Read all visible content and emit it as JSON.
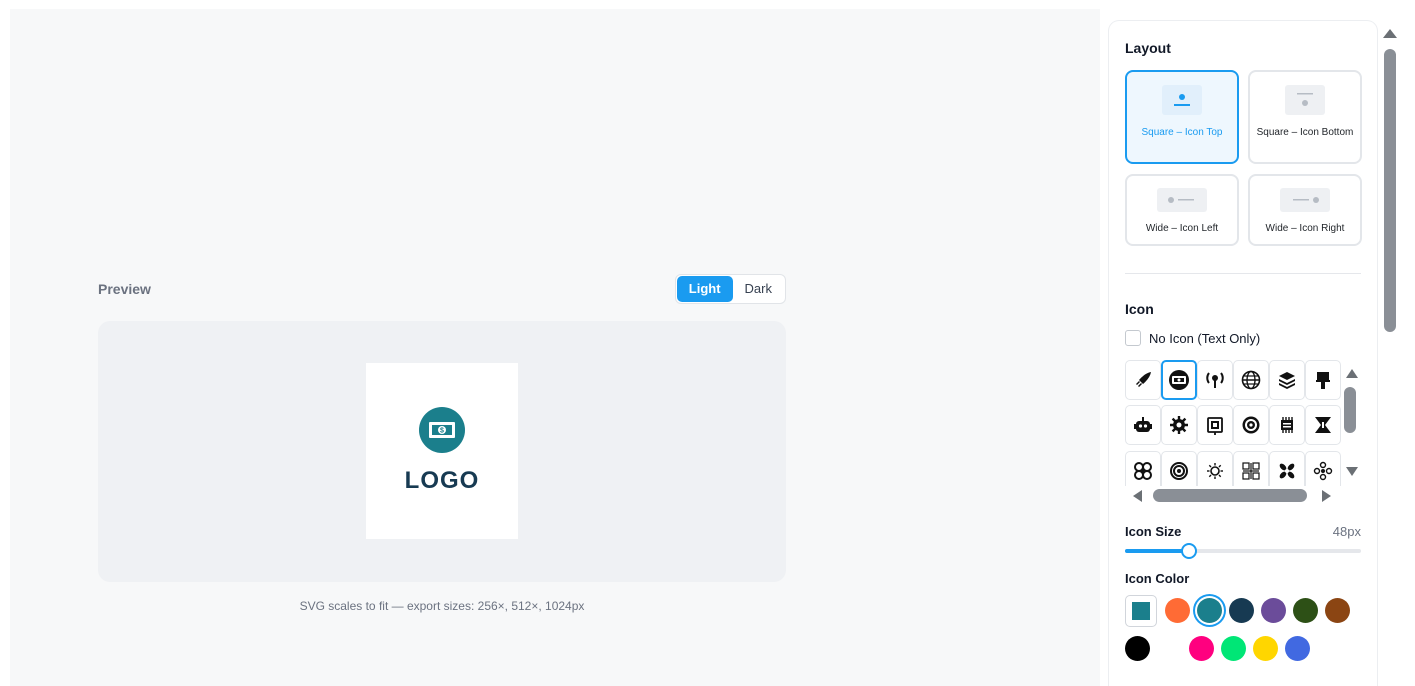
{
  "preview": {
    "title": "Preview",
    "theme_light": "Light",
    "theme_dark": "Dark",
    "logo_text": "LOGO",
    "caption": "SVG scales to fit — export sizes: 256×, 512×, 1024px"
  },
  "layout": {
    "title": "Layout",
    "options": [
      {
        "label": "Square – Icon Top",
        "selected": true
      },
      {
        "label": "Square – Icon Bottom",
        "selected": false
      },
      {
        "label": "Wide – Icon Left",
        "selected": false
      },
      {
        "label": "Wide – Icon Right",
        "selected": false
      }
    ]
  },
  "icon": {
    "title": "Icon",
    "no_icon_label": "No Icon (Text Only)",
    "no_icon_checked": false,
    "grid": [
      [
        "rocket-icon",
        "money-icon",
        "wifi-pin-icon",
        "globe-icon",
        "layers-icon",
        "paint-brush-icon"
      ],
      [
        "robot-icon",
        "gear-icon",
        "circuit-board-icon",
        "target-gear-icon",
        "chip-icon",
        "hourglass-icon"
      ],
      [
        "clover-icon",
        "spiral-icon",
        "sun-icon",
        "grid-pattern-icon",
        "flower-icon",
        "pinwheel-icon"
      ]
    ],
    "selected": "money-icon"
  },
  "icon_size": {
    "label": "Icon Size",
    "value": "48px",
    "fraction": 0.27
  },
  "icon_color": {
    "label": "Icon Color",
    "current": "#1b7f8c",
    "swatches": [
      "#ff6b35",
      "#1b7f8c",
      "#173a52",
      "#6b4c9a",
      "#2d5016",
      "#8b4513",
      "#000000",
      "#ffffff",
      "#ff007f",
      "#00e676",
      "#ffd600",
      "#4169e1"
    ],
    "selected": "#1b7f8c"
  }
}
